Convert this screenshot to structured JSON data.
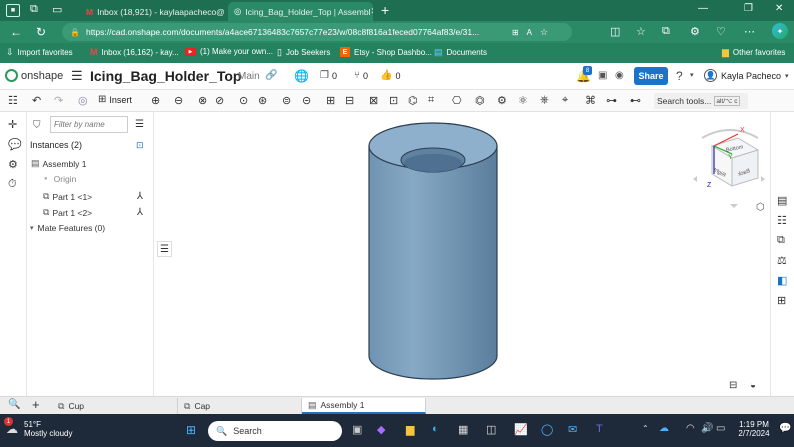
{
  "browser": {
    "tabs": [
      {
        "label": "Inbox (18,921) - kaylaapacheco@"
      },
      {
        "label": "Icing_Bag_Holder_Top | Assembl"
      }
    ],
    "url": "https://cad.onshape.com/documents/a4ace67136483c7657c77e23/w/08c8f816a1feced07764af83/e/31...",
    "favorites": [
      {
        "label": "Import favorites"
      },
      {
        "label": "Inbox (16,162) - kay..."
      },
      {
        "label": "(1) Make your own..."
      },
      {
        "label": "Job Seekers"
      },
      {
        "label": "Etsy - Shop Dashbo..."
      },
      {
        "label": "Documents"
      }
    ],
    "other_favorites": "Other favorites"
  },
  "onshape": {
    "logo": "onshape",
    "doc_title": "Icing_Bag_Holder_Top",
    "branch": "Main",
    "counts": {
      "versions": "0",
      "branches": "0",
      "likes": "0"
    },
    "notif_badge": "8",
    "share_label": "Share",
    "user": "Kayla Pacheco",
    "insert_label": "Insert",
    "search_tools": "Search tools...",
    "shortcut": "alt/⌥ c"
  },
  "panel": {
    "filter_placeholder": "Filter by name",
    "instances_label": "Instances (2)",
    "assembly": "Assembly 1",
    "origin": "Origin",
    "parts": [
      "Part 1 <1>",
      "Part 1 <2>"
    ],
    "mate_features": "Mate Features (0)"
  },
  "viewcube": {
    "top": "Bottom",
    "front": "Right",
    "side": "Back",
    "x": "X",
    "y": "Y",
    "z": "Z"
  },
  "bottom_tabs": [
    {
      "label": "Cup"
    },
    {
      "label": "Cap"
    },
    {
      "label": "Assembly 1"
    }
  ],
  "taskbar": {
    "weather_temp": "51°F",
    "weather_desc": "Mostly cloudy",
    "weather_badge": "1",
    "search": "Search",
    "time": "1:19 PM",
    "date": "2/7/2024"
  },
  "colors": {
    "browser_green": "#2a8a66",
    "accent_blue": "#1a73c9",
    "part_blue": "#7fa3c0"
  }
}
